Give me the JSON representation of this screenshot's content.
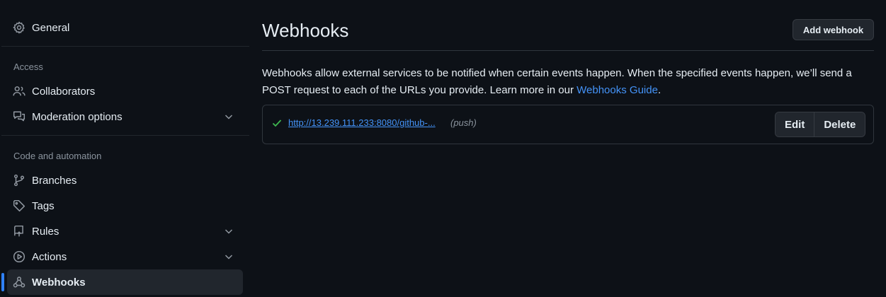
{
  "sidebar": {
    "general": {
      "label": "General",
      "icon": "gear-icon"
    },
    "sections": [
      {
        "title": "Access"
      },
      {
        "title": "Code and automation"
      }
    ],
    "access_items": [
      {
        "label": "Collaborators",
        "icon": "people-icon"
      },
      {
        "label": "Moderation options",
        "icon": "comment-discussion-icon",
        "expandable": true
      }
    ],
    "code_items": [
      {
        "label": "Branches",
        "icon": "git-branch-icon"
      },
      {
        "label": "Tags",
        "icon": "tag-icon"
      },
      {
        "label": "Rules",
        "icon": "repo-push-icon",
        "expandable": true
      },
      {
        "label": "Actions",
        "icon": "play-icon",
        "expandable": true
      },
      {
        "label": "Webhooks",
        "icon": "webhook-icon",
        "active": true
      }
    ]
  },
  "main": {
    "title": "Webhooks",
    "add_button": "Add webhook",
    "description": {
      "text": "Webhooks allow external services to be notified when certain events happen. When the specified events happen, we’ll send a POST request to each of the URLs you provide. Learn more in our ",
      "link": "Webhooks Guide",
      "suffix": "."
    },
    "webhooks": [
      {
        "status": "success",
        "url": "http://13.239.111.233:8080/github-...",
        "events": "(push)",
        "edit_label": "Edit",
        "delete_label": "Delete"
      }
    ]
  },
  "colors": {
    "background": "#0d1117",
    "link": "#4493f8",
    "success": "#3fb950",
    "active_indicator": "#2f81f7",
    "border": "#30363d"
  }
}
